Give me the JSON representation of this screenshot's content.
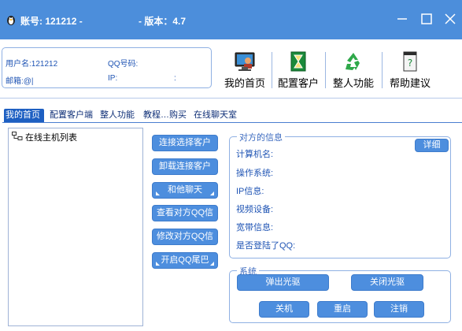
{
  "title_bar": {
    "account": "账号: 121212 -",
    "version": "- 版本：4.7"
  },
  "user_info": {
    "username_label": "用户名:121212",
    "qq_label": "QQ号码:",
    "email_label": "邮箱:@|",
    "ip_label": "IP:",
    "ip_sep": ":"
  },
  "toolbar": {
    "items": [
      {
        "label": "我的首页",
        "icon": "monitor-user-icon"
      },
      {
        "label": "配置客户",
        "icon": "hourglass-icon"
      },
      {
        "label": "整人功能",
        "icon": "recycle-icon"
      },
      {
        "label": "帮助建议",
        "icon": "document-help-icon"
      }
    ]
  },
  "tabs": [
    "我的首页",
    "配置客户端",
    "整人功能",
    "教程…购买",
    "在线聊天室"
  ],
  "active_tab": 0,
  "tree": {
    "root": "在线主机列表"
  },
  "actions": {
    "connect": "连接选择客户",
    "unload": "卸载连接客户",
    "chat": "和他聊天",
    "view_qq": "查看对方QQ信息",
    "modify_qq": "修改对方QQ信息",
    "qq_tail": "开启QQ尾巴"
  },
  "peer_info": {
    "legend": "对方的信息",
    "detail_button": "详细",
    "fields": [
      "计算机名:",
      "操作系统:",
      "IP信息:",
      "视频设备:",
      "宽带信息:",
      "是否登陆了QQ:"
    ]
  },
  "system": {
    "legend": "系统",
    "eject_cd": "弹出光驱",
    "close_cd": "关闭光驱",
    "shutdown": "关机",
    "restart": "重启",
    "logoff": "注销"
  },
  "colors": {
    "titlebar": "#4c8edb",
    "button": "#4d8ede",
    "active_tab": "#1d5fc2",
    "label_text": "#1f54b4"
  }
}
